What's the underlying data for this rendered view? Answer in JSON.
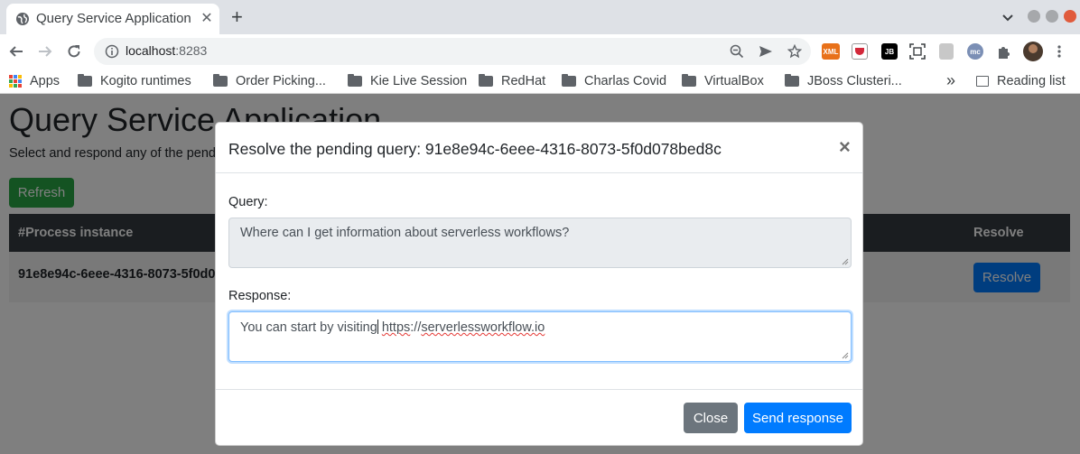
{
  "browser": {
    "tab_title": "Query Service Application",
    "url_host": "localhost",
    "url_port": ":8283",
    "icons": [
      "globe-icon",
      "close-icon",
      "plus-icon",
      "back-icon",
      "forward-icon",
      "reload-icon",
      "info-icon",
      "zoom-icon",
      "send-icon",
      "star-icon",
      "extensions-icon"
    ],
    "extension_labels": {
      "xml": "XML",
      "jb": "JB",
      "mc": "mc"
    }
  },
  "bookmarks": {
    "apps": "Apps",
    "items": [
      "Kogito runtimes",
      "Order Picking...",
      "Kie Live Session",
      "RedHat",
      "Charlas Covid",
      "VirtualBox",
      "JBoss Clusteri..."
    ],
    "more": "»",
    "reading_list": "Reading list"
  },
  "page": {
    "title": "Query Service Application",
    "subtitle": "Select and respond any of the pendi",
    "refresh_label": "Refresh",
    "table": {
      "headers": [
        "#Process instance",
        "Resolve"
      ],
      "rows": [
        {
          "process_instance": "91e8e94c-6eee-4316-8073-5f0d0",
          "action": "Resolve"
        }
      ]
    }
  },
  "modal": {
    "title": "Resolve the pending query: 91e8e94c-6eee-4316-8073-5f0d078bed8c",
    "close_symbol": "×",
    "query_label": "Query:",
    "query_value": "Where can I get information about serverless workflows?",
    "response_label": "Response:",
    "response_before_caret": "You can start by visiting",
    "response_url_a": "https",
    "response_url_sep": "://",
    "response_url_b": "serverlessworkflow.io",
    "close_button": "Close",
    "send_button": "Send response"
  },
  "colors": {
    "success": "#28a745",
    "primary": "#007bff",
    "secondary": "#6c757d",
    "table_header": "#343a40"
  }
}
